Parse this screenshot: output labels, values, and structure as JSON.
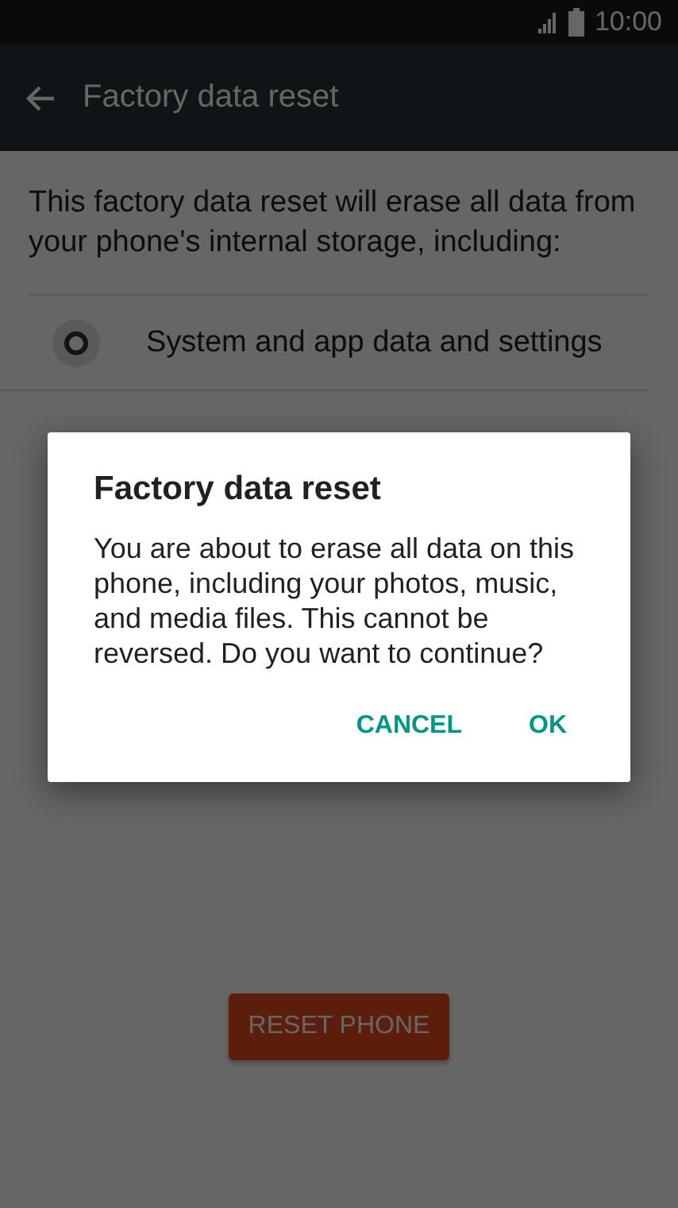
{
  "status_bar": {
    "time": "10:00"
  },
  "app_bar": {
    "title": "Factory data reset"
  },
  "intro": "This factory data reset will erase all data from your phone's internal storage, including:",
  "items": [
    {
      "label": "System and app data and settings"
    }
  ],
  "reset_button": "RESET PHONE",
  "dialog": {
    "title": "Factory data reset",
    "message": "You are about to erase all data on this phone, including your photos, music, and media files. This cannot be reversed. Do you want to continue?",
    "buttons": [
      "CANCEL",
      "OK"
    ]
  }
}
